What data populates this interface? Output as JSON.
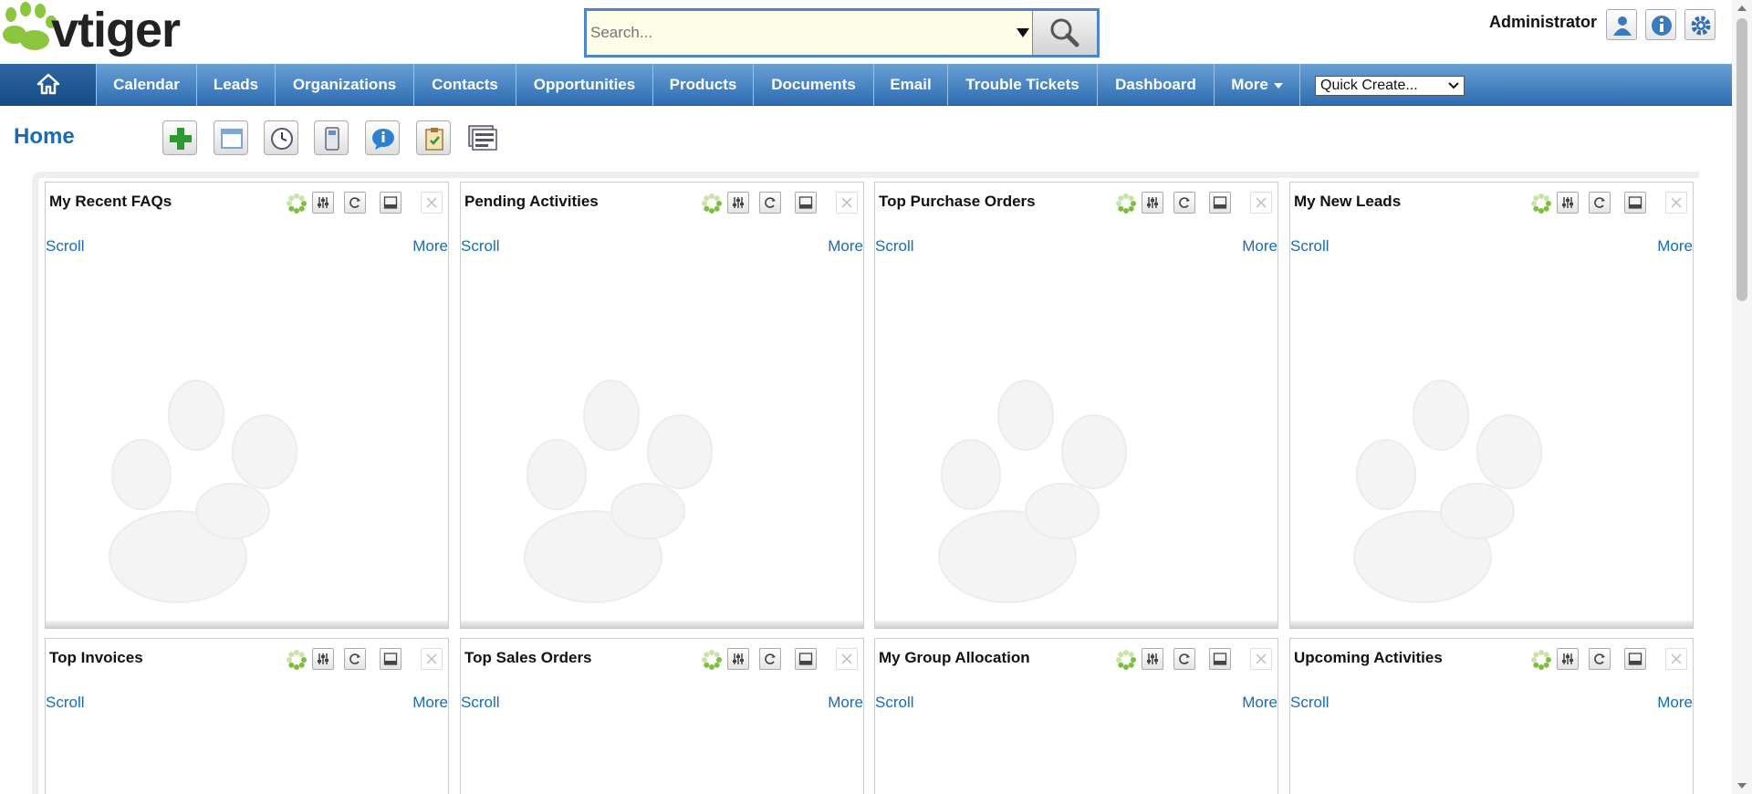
{
  "app": {
    "logo_text": "vtiger",
    "brand_colors": {
      "paw": "#8cc63f",
      "nav": "#3a7bc0",
      "link": "#1a6bb5"
    }
  },
  "header": {
    "search": {
      "placeholder": "Search...",
      "icon": "magnifier-icon"
    },
    "user_name": "Administrator",
    "icons": [
      "user-icon",
      "info-icon",
      "gear-icon"
    ]
  },
  "nav": {
    "items": [
      {
        "label": "Calendar"
      },
      {
        "label": "Leads"
      },
      {
        "label": "Organizations"
      },
      {
        "label": "Contacts"
      },
      {
        "label": "Opportunities"
      },
      {
        "label": "Products"
      },
      {
        "label": "Documents"
      },
      {
        "label": "Email"
      },
      {
        "label": "Trouble Tickets"
      },
      {
        "label": "Dashboard"
      },
      {
        "label": "More"
      }
    ],
    "quick_create": "Quick Create..."
  },
  "page": {
    "title": "Home",
    "toolbar": [
      "add-widget-icon",
      "calendar-widget-icon",
      "clock-icon",
      "calculator-icon",
      "chat-icon",
      "clipboard-icon",
      "layout-icon"
    ]
  },
  "widgets": [
    {
      "title": "My Recent FAQs",
      "scroll": "Scroll",
      "more": "More"
    },
    {
      "title": "Pending Activities",
      "scroll": "Scroll",
      "more": "More"
    },
    {
      "title": "Top Purchase Orders",
      "scroll": "Scroll",
      "more": "More"
    },
    {
      "title": "My New Leads",
      "scroll": "Scroll",
      "more": "More"
    },
    {
      "title": "Top Invoices",
      "scroll": "Scroll",
      "more": "More"
    },
    {
      "title": "Top Sales Orders",
      "scroll": "Scroll",
      "more": "More"
    },
    {
      "title": "My Group Allocation",
      "scroll": "Scroll",
      "more": "More"
    },
    {
      "title": "Upcoming Activities",
      "scroll": "Scroll",
      "more": "More"
    }
  ]
}
